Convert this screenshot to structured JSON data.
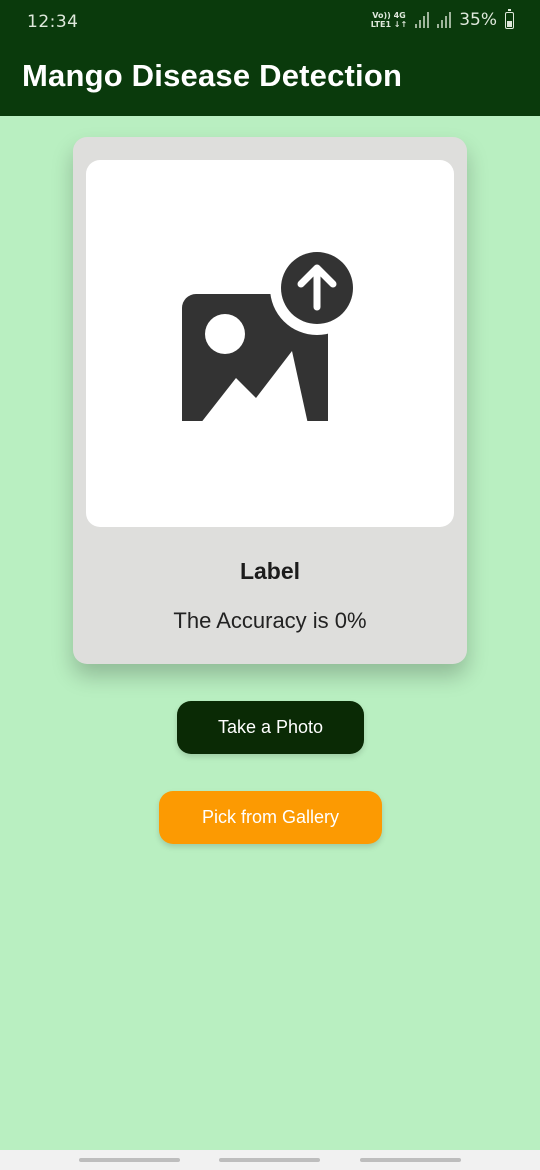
{
  "status_bar": {
    "time": "12:34",
    "net_top": "Vo)) 4G",
    "net_bottom": "LTE1 ↓↑",
    "battery": "35%"
  },
  "app_bar": {
    "title": "Mango Disease Detection"
  },
  "result_card": {
    "image_icon": "image-upload-icon",
    "label": "Label",
    "accuracy": "The Accuracy is 0%"
  },
  "actions": {
    "take_photo": "Take a Photo",
    "pick_gallery": "Pick from Gallery"
  },
  "colors": {
    "app_bar": "#0a3a0c",
    "background": "#b9efc1",
    "card": "#dededc",
    "take_photo_button": "#0a2a05",
    "gallery_button": "#fc9a02"
  }
}
